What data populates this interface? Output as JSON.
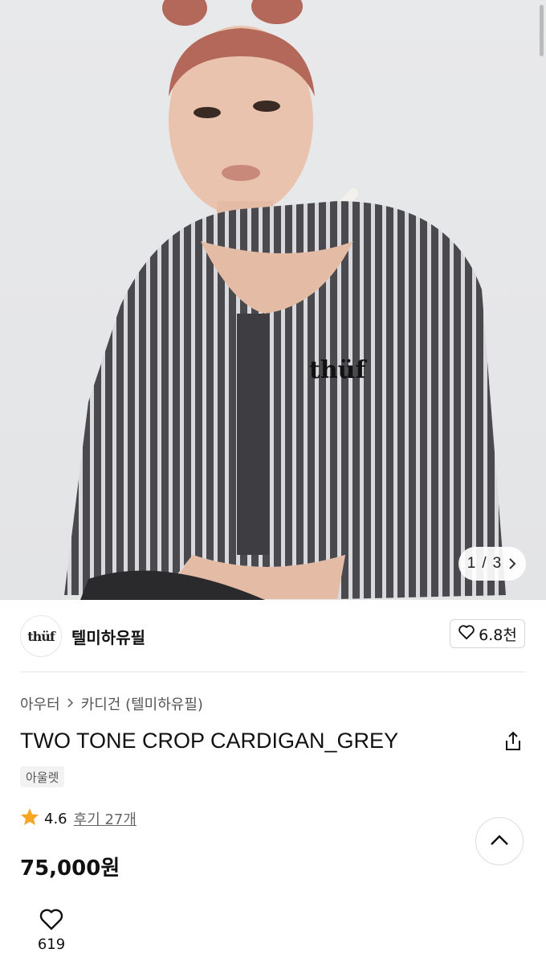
{
  "gallery": {
    "current": "1",
    "separator": "/",
    "total": "3",
    "next_icon": "chevron-right-icon"
  },
  "brand": {
    "logo_text": "thüf",
    "name": "텔미하유필",
    "like_icon": "heart-outline-icon",
    "like_count": "6.8천"
  },
  "breadcrumb": {
    "items": [
      "아우터",
      "카디건 (텔미하유필)"
    ],
    "separator_icon": "chevron-right-icon"
  },
  "product": {
    "title": "TWO TONE CROP CARDIGAN_GREY",
    "tag": "아울렛",
    "rating": "4.6",
    "review_label": "후기 27개",
    "price": "75,000원",
    "share_icon": "share-icon"
  },
  "actions": {
    "scroll_top_icon": "chevron-up-icon",
    "wish_icon": "heart-outline-icon",
    "wish_count": "619"
  },
  "colors": {
    "star": "#f6a623",
    "text_primary": "#111111",
    "text_secondary": "#555555"
  }
}
